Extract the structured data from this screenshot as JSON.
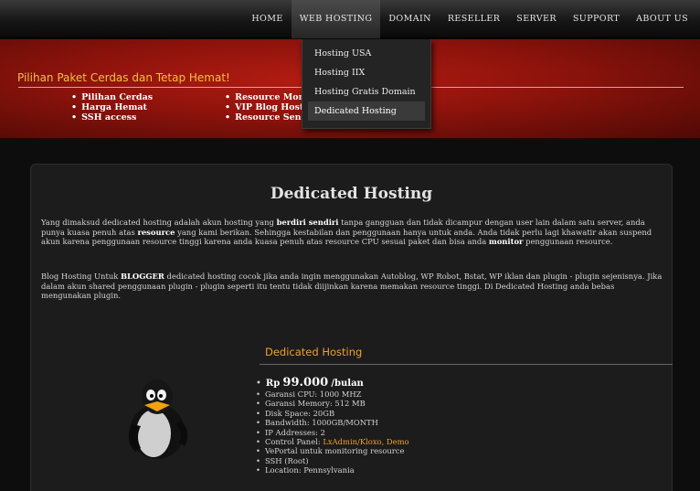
{
  "nav": {
    "items": [
      {
        "label": "HOME"
      },
      {
        "label": "WEB HOSTING",
        "active": true
      },
      {
        "label": "DOMAIN"
      },
      {
        "label": "RESELLER"
      },
      {
        "label": "SERVER"
      },
      {
        "label": "SUPPORT"
      },
      {
        "label": "ABOUT US"
      }
    ]
  },
  "dropdown": {
    "items": [
      {
        "label": "Hosting USA"
      },
      {
        "label": "Hosting IIX"
      },
      {
        "label": "Hosting Gratis Domain"
      },
      {
        "label": "Dedicated Hosting",
        "selected": true
      }
    ]
  },
  "banner": {
    "title": "Pilihan Paket Cerdas dan Tetap Hemat!",
    "col1": [
      "Pilihan Cerdas",
      "Harga Hemat",
      "SSH access"
    ],
    "col2": [
      "Resource Monitor",
      "VIP Blog Hosting",
      "Resource Sendiri"
    ]
  },
  "content": {
    "title": "Dedicated Hosting",
    "p1": {
      "t1": "Yang dimaksud dedicated hosting adalah akun hosting yang ",
      "b1": "berdiri sendiri",
      "t2": " tanpa gangguan dan tidak dicampur dengan user lain dalam satu server, anda punya kuasa penuh atas ",
      "b2": "resource",
      "t3": " yang kami berikan. Sehingga kestabilan dan penggunaan hanya untuk anda. Anda tidak perlu lagi khawatir akan suspend akun karena penggunaan resource tinggi karena anda kuasa penuh atas resource CPU sesuai paket dan bisa anda ",
      "b3": "monitor",
      "t4": " penggunaan resource."
    },
    "p2": {
      "t1": "Blog Hosting Untuk ",
      "b1": "BLOGGER",
      "t2": " dedicated hosting cocok jika anda ingin menggunakan Autoblog, WP Robot, Bstat, WP iklan dan plugin - plugin sejenisnya. Jika dalam akun shared penggunaan plugin - plugin seperti itu tentu tidak diijinkan karena memakan resource tinggi. Di Dedicated Hosting anda bebas mengunakan plugin."
    }
  },
  "plan": {
    "title": "Dedicated Hosting",
    "price_prefix": "Rp",
    "price": "99.000",
    "price_suffix": "/bulan",
    "features": [
      "Garansi CPU: 1000 MHZ",
      "Garansi Memory: 512 MB",
      "Disk Space: 20GB",
      "Bandwidth: 1000GB/MONTH",
      "IP Addresses: 2"
    ],
    "control_panel_label": "Control Panel: ",
    "control_panel_links": "LxAdmin/Kloxo, Demo",
    "features2": [
      "VePortal untuk monitoring resource",
      "SSH (Root)",
      "Location: Pennsylvania"
    ]
  },
  "colors": {
    "accent": "#f0a030",
    "banner_red": "#8d130c"
  }
}
